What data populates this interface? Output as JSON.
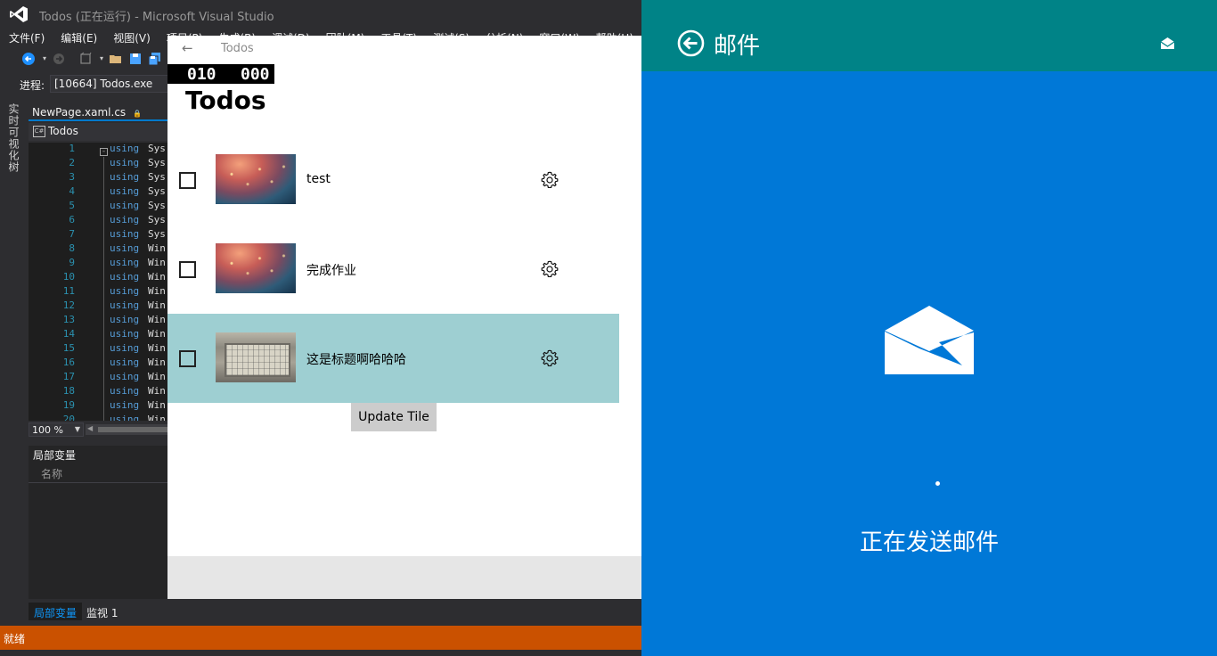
{
  "vs": {
    "window_title": "Todos (正在运行) - Microsoft Visual Studio",
    "menu": [
      "文件(F)",
      "编辑(E)",
      "视图(V)",
      "项目(P)",
      "生成(B)",
      "调试(D)",
      "团队(M)",
      "工具(T)",
      "测试(S)",
      "分析(N)",
      "窗口(W)",
      "帮助(H)"
    ],
    "process_label": "进程:",
    "process_value": "[10664] Todos.exe",
    "side_tab": "实时可视化树",
    "doc_tab": "NewPage.xaml.cs",
    "doc_tab_pin": "🔒",
    "nav_icon": "C#",
    "nav_value": "Todos",
    "code_lines": [
      {
        "n": "1",
        "kw": "using",
        "ns": "Sys"
      },
      {
        "n": "2",
        "kw": "using",
        "ns": "Sys"
      },
      {
        "n": "3",
        "kw": "using",
        "ns": "Sys"
      },
      {
        "n": "4",
        "kw": "using",
        "ns": "Sys"
      },
      {
        "n": "5",
        "kw": "using",
        "ns": "Sys"
      },
      {
        "n": "6",
        "kw": "using",
        "ns": "Sys"
      },
      {
        "n": "7",
        "kw": "using",
        "ns": "Sys"
      },
      {
        "n": "8",
        "kw": "using",
        "ns": "Win"
      },
      {
        "n": "9",
        "kw": "using",
        "ns": "Win"
      },
      {
        "n": "10",
        "kw": "using",
        "ns": "Win"
      },
      {
        "n": "11",
        "kw": "using",
        "ns": "Win"
      },
      {
        "n": "12",
        "kw": "using",
        "ns": "Win"
      },
      {
        "n": "13",
        "kw": "using",
        "ns": "Win"
      },
      {
        "n": "14",
        "kw": "using",
        "ns": "Win"
      },
      {
        "n": "15",
        "kw": "using",
        "ns": "Win"
      },
      {
        "n": "16",
        "kw": "using",
        "ns": "Win"
      },
      {
        "n": "17",
        "kw": "using",
        "ns": "Win"
      },
      {
        "n": "18",
        "kw": "using",
        "ns": "Win"
      },
      {
        "n": "19",
        "kw": "using",
        "ns": "Win"
      },
      {
        "n": "20",
        "kw": "using",
        "ns": "Win"
      }
    ],
    "zoom": "100 %",
    "locals_title": "局部变量",
    "locals_column": "名称",
    "bottom_tab_locals": "局部变量",
    "bottom_tab_watch": "监视 1",
    "status": "就绪",
    "colors": {
      "status_bar": "#ca5100",
      "accent": "#007acc"
    }
  },
  "todos": {
    "app_title": "Todos",
    "back_glyph": "←",
    "frame_counter_a": "010",
    "frame_counter_b": "000",
    "heading": "Todos",
    "items": [
      {
        "title": "test",
        "checked": false,
        "thumb": "sparkle",
        "selected": false
      },
      {
        "title": "完成作业",
        "checked": false,
        "thumb": "sparkle",
        "selected": false
      },
      {
        "title": "这是标题啊哈哈哈",
        "checked": false,
        "thumb": "box",
        "selected": true
      }
    ],
    "update_button": "Update Tile",
    "colors": {
      "selected_row": "#9ecfd2"
    }
  },
  "mail": {
    "title": "邮件",
    "status": "正在发送邮件",
    "icons": [
      "back-arrow-circle-icon",
      "open-envelope-icon",
      "envelope-icon"
    ],
    "colors": {
      "background": "#0078d7",
      "header": "#008387"
    }
  }
}
